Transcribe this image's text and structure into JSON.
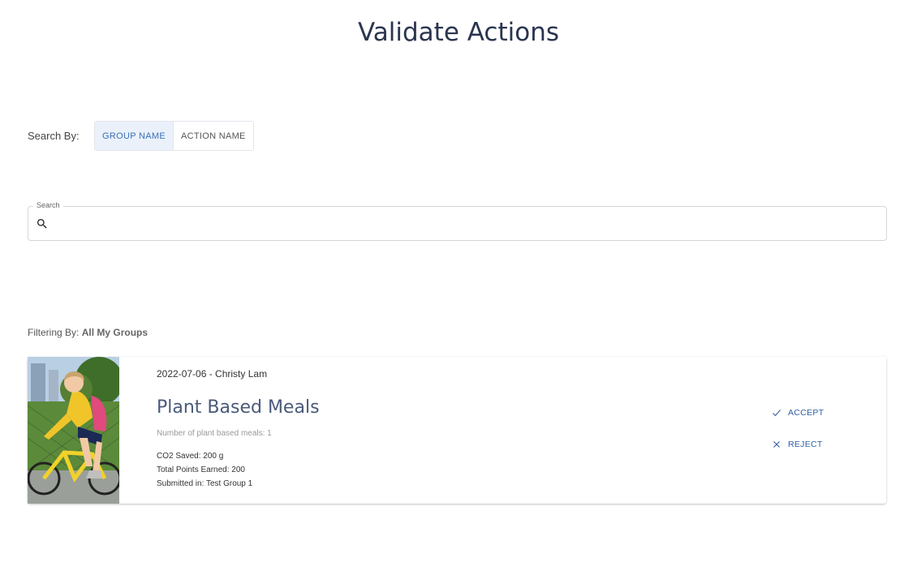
{
  "page": {
    "title": "Validate Actions"
  },
  "search_by": {
    "label": "Search By:",
    "options": [
      "GROUP NAME",
      "ACTION NAME"
    ],
    "selected": "GROUP NAME"
  },
  "search": {
    "legend": "Search",
    "value": "",
    "icon": "search-icon"
  },
  "filter": {
    "label": "Filtering By:",
    "value": "All My Groups"
  },
  "actions": [
    {
      "meta": "2022-07-06 - Christy Lam",
      "title": "Plant Based Meals",
      "description": "Number of plant based meals: 1",
      "co2": "CO2 Saved: 200 g",
      "points": "Total Points Earned: 200",
      "group": "Submitted in: Test Group 1",
      "accept_label": "ACCEPT",
      "reject_label": "REJECT"
    }
  ],
  "colors": {
    "accent": "#2f5fa3",
    "title": "#2b3550",
    "active_toggle_bg": "#eaf1fb"
  }
}
